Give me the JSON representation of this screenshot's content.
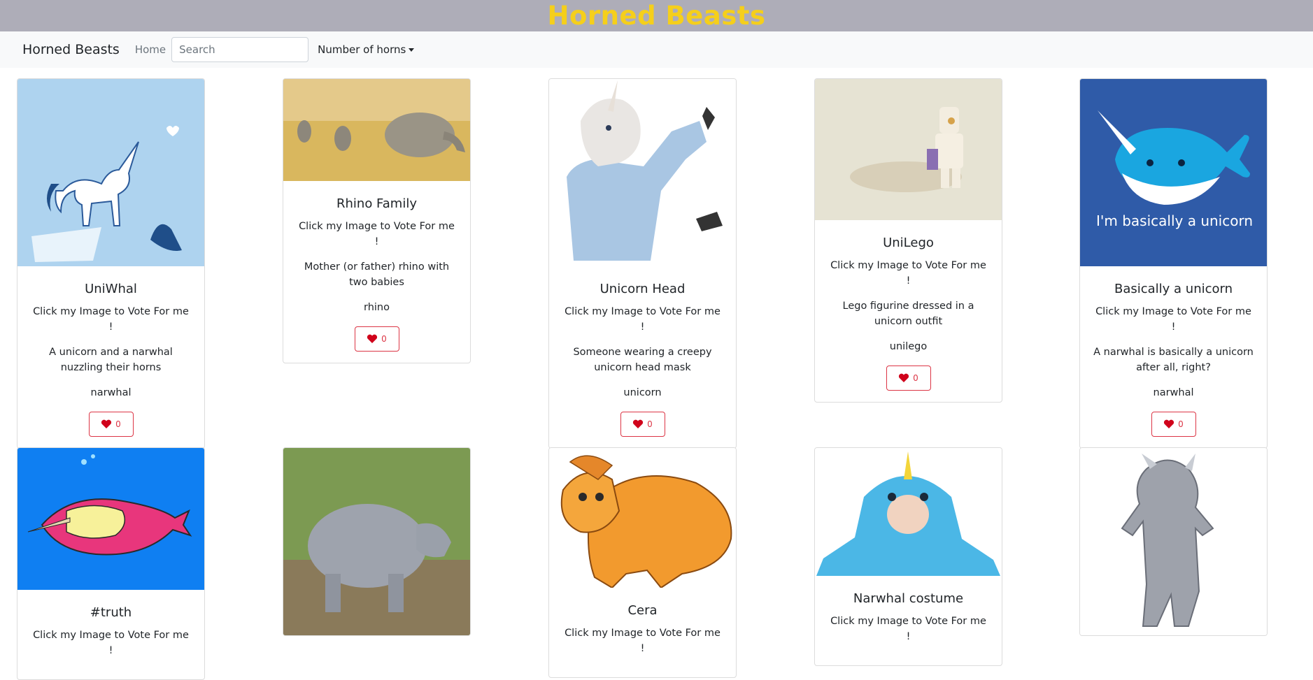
{
  "header": {
    "title": "Horned Beasts"
  },
  "nav": {
    "brand": "Horned Beasts",
    "home": "Home",
    "search_placeholder": "Search",
    "dropdown_label": "Number of horns"
  },
  "cards": [
    {
      "title": "UniWhal",
      "prompt": "Click my Image to Vote For me !",
      "description": "A unicorn and a narwhal nuzzling their horns",
      "keyword": "narwhal",
      "votes": "0",
      "image": "unicorn-narwhal-illustration"
    },
    {
      "title": "Rhino Family",
      "prompt": "Click my Image to Vote For me !",
      "description": "Mother (or father) rhino with two babies",
      "keyword": "rhino",
      "votes": "0",
      "image": "rhino-family-photo"
    },
    {
      "title": "Unicorn Head",
      "prompt": "Click my Image to Vote For me !",
      "description": "Someone wearing a creepy unicorn head mask",
      "keyword": "unicorn",
      "votes": "0",
      "image": "unicorn-mask-photo"
    },
    {
      "title": "UniLego",
      "prompt": "Click my Image to Vote For me !",
      "description": "Lego figurine dressed in a unicorn outfit",
      "keyword": "unilego",
      "votes": "0",
      "image": "lego-unicorn-photo"
    },
    {
      "title": "Basically a unicorn",
      "prompt": "Click my Image to Vote For me !",
      "description": "A narwhal is basically a unicorn after all, right?",
      "keyword": "narwhal",
      "votes": "0",
      "image": "narwhal-cartoon",
      "image_text": "I'm basically a unicorn"
    },
    {
      "title": "#truth",
      "prompt": "Click my Image to Vote For me !",
      "image": "truth-narwhal-drawing"
    },
    {
      "title": "",
      "prompt": "",
      "image": "baby-rhino-photo"
    },
    {
      "title": "Cera",
      "prompt": "Click my Image to Vote For me !",
      "image": "cera-dinosaur-cartoon"
    },
    {
      "title": "Narwhal costume",
      "prompt": "Click my Image to Vote For me !",
      "image": "narwhal-costume-photo"
    },
    {
      "title": "",
      "prompt": "",
      "image": "rhino-mascot-photo"
    }
  ],
  "colors": {
    "header_bg": "#aeadb8",
    "title": "#f5cf1b",
    "navbar_bg": "#f8f9fa",
    "vote": "#dc3545"
  }
}
